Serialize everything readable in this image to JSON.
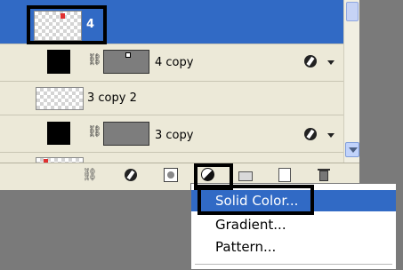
{
  "layers": [
    {
      "id": "layer-4",
      "name": "4",
      "selected": true
    },
    {
      "id": "layer-4-copy",
      "name": "4 copy",
      "selected": false
    },
    {
      "id": "layer-3-copy-2",
      "name": "3 copy 2",
      "selected": false
    },
    {
      "id": "layer-3-copy",
      "name": "3 copy",
      "selected": false
    }
  ],
  "menu": {
    "items": [
      "Solid Color...",
      "Gradient...",
      "Pattern..."
    ],
    "highlighted": "Solid Color..."
  },
  "colors": {
    "selection": "#316ac5",
    "panel_bg": "#ece9d8",
    "background": "#7a7a7a"
  },
  "toolbar_icons": [
    "link-layers-icon",
    "layer-style-icon",
    "add-mask-icon",
    "adjustment-layer-icon",
    "new-group-icon",
    "new-layer-icon",
    "trash-icon"
  ]
}
